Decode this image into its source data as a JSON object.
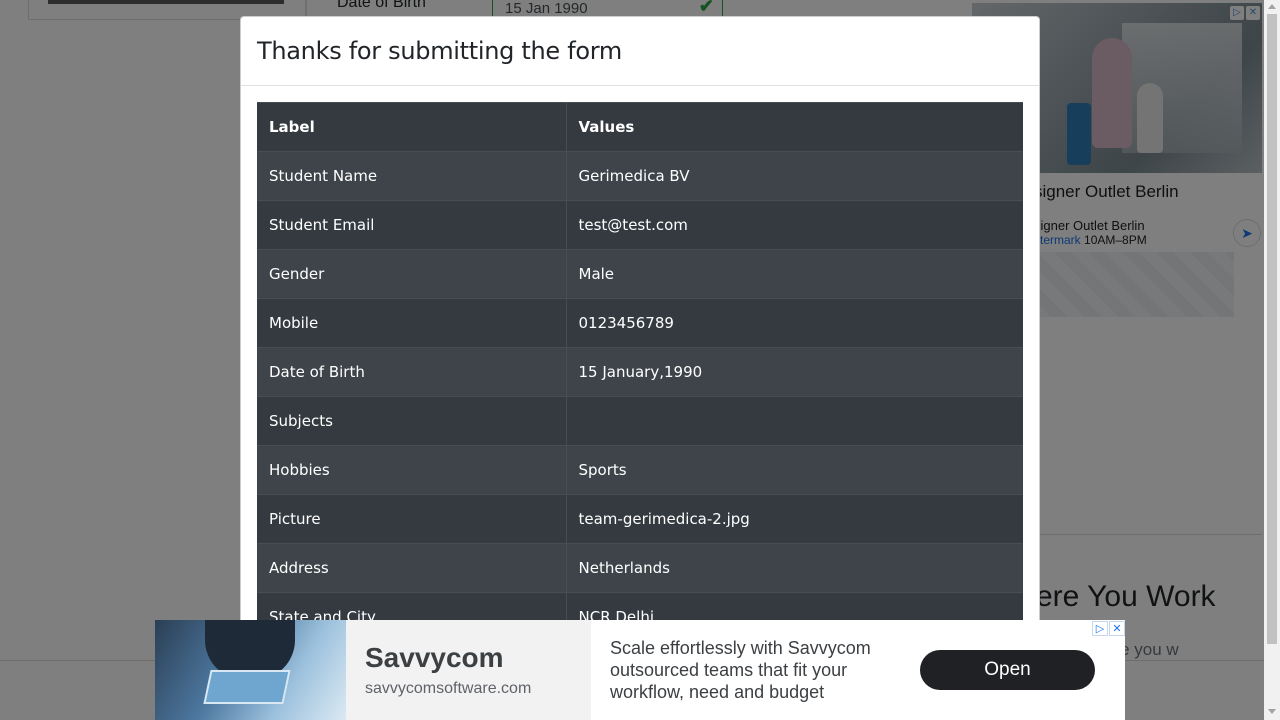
{
  "background": {
    "dob_label": "Date of Birth",
    "dob_value": "15 Jan 1990",
    "right_heading": "ere You Work",
    "right_subtext": "ns to ensure you w"
  },
  "right_ad": {
    "title": "signer Outlet Berlin",
    "subtitle": "signer Outlet Berlin",
    "location_link": "stermark",
    "hours": "10AM–8PM",
    "icon": "directions-icon"
  },
  "modal": {
    "title": "Thanks for submitting the form",
    "table": {
      "headers": [
        "Label",
        "Values"
      ],
      "rows": [
        {
          "label": "Student Name",
          "value": "Gerimedica BV"
        },
        {
          "label": "Student Email",
          "value": "test@test.com"
        },
        {
          "label": "Gender",
          "value": "Male"
        },
        {
          "label": "Mobile",
          "value": "0123456789"
        },
        {
          "label": "Date of Birth",
          "value": "15 January,1990"
        },
        {
          "label": "Subjects",
          "value": ""
        },
        {
          "label": "Hobbies",
          "value": "Sports"
        },
        {
          "label": "Picture",
          "value": "team-gerimedica-2.jpg"
        },
        {
          "label": "Address",
          "value": "Netherlands"
        },
        {
          "label": "State and City",
          "value": "NCR Delhi"
        }
      ]
    }
  },
  "bottom_ad": {
    "brand": "Savvycom",
    "domain": "savvycomsoftware.com",
    "description": "Scale effortlessly with Savvycom outsourced teams that fit your workflow, need and budget",
    "cta": "Open"
  },
  "colors": {
    "table_dark": "#343a40",
    "table_striped": "#3e444a",
    "valid_green": "#28a745",
    "cta_dark": "#202124"
  }
}
